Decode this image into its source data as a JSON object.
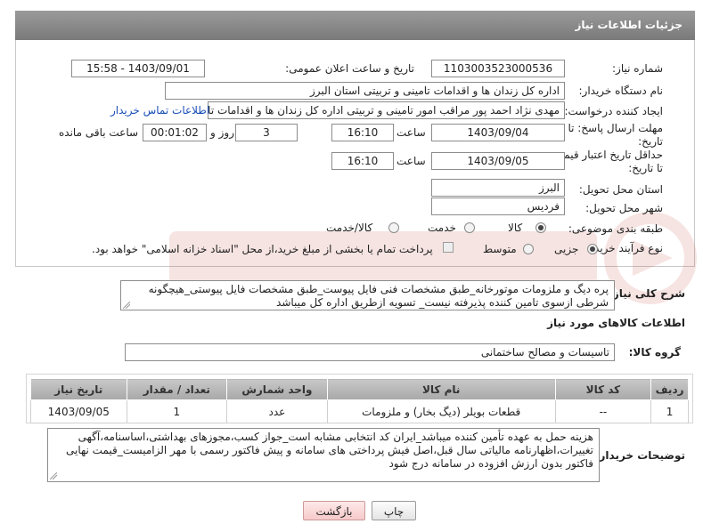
{
  "header": {
    "title": "جزئیات اطلاعات نیاز"
  },
  "fields": {
    "need_number": {
      "label": "شماره نیاز:",
      "value": "1103003523000536"
    },
    "announce": {
      "label": "تاریخ و ساعت اعلان عمومی:",
      "value": "1403/09/01 - 15:58"
    },
    "buyer_org": {
      "label": "نام دستگاه خریدار:",
      "value": "اداره کل زندان ها و اقدامات تامینی و تربیتی استان البرز"
    },
    "requester": {
      "label": "ایجاد کننده درخواست:",
      "value": "مهدی نژاد احمد پور مراقب امور تامینی و تربیتی اداره کل زندان ها و اقدامات تامینی",
      "link": "اطلاعات تماس خریدار"
    },
    "deadline": {
      "label": "مهلت ارسال پاسخ: تا تاریخ:",
      "date": "1403/09/04",
      "time_label": "ساعت",
      "time": "16:10",
      "days": "3",
      "days_label": "روز و",
      "remaining": "00:01:02",
      "remaining_label": "ساعت باقی مانده"
    },
    "validity": {
      "label": "حداقل تاریخ اعتبار قیمت: تا تاریخ:",
      "date": "1403/09/05",
      "time_label": "ساعت",
      "time": "16:10"
    },
    "province": {
      "label": "استان محل تحویل:",
      "value": "البرز"
    },
    "city": {
      "label": "شهر محل تحویل:",
      "value": "فردیس"
    },
    "category": {
      "label": "طبقه بندی موضوعی:",
      "options": [
        "کالا",
        "خدمت",
        "کالا/خدمت"
      ],
      "selected": "کالا"
    },
    "process": {
      "label": "نوع فرآیند خرید :",
      "options": [
        "جزیی",
        "متوسط"
      ],
      "selected": "جزیی",
      "note": "پرداخت تمام یا بخشی از مبلغ خرید،از محل \"اسناد خزانه اسلامی\" خواهد بود."
    }
  },
  "description": {
    "label": "شرح کلی نیاز:",
    "text": "پره دیگ و ملزومات موتورخانه_طبق مشخصات فنی فایل پیوست_طبق مشخصات فایل پیوستی_هیچگونه شرطی ازسوی تامین کننده پذیرفته نیست_ تسویه ازطریق اداره کل میباشد"
  },
  "goods_section": {
    "title": "اطلاعات کالاهای مورد نیاز",
    "group_label": "گروه کالا:",
    "group_value": "تاسیسات و مصالح ساختمانی"
  },
  "table": {
    "headers": [
      "ردیف",
      "کد کالا",
      "نام کالا",
      "واحد شمارش",
      "تعداد / مقدار",
      "تاریخ نیاز"
    ],
    "rows": [
      [
        "1",
        "--",
        "قطعات بویلر (دیگ بخار) و ملزومات",
        "عدد",
        "1",
        "1403/09/05"
      ]
    ]
  },
  "buyer_notes": {
    "label": "توضیحات خریدار:",
    "text": "هزینه حمل به عهده تأمین کننده میباشد_ایران کد انتخابی مشابه است_جواز کسب،مجوزهای بهداشتی،اساسنامه،آگهی تغییرات،اظهارنامه مالیاتی سال قبل،اصل فیش پرداختی های سامانه و پیش فاکتور رسمی با مهر الزامیست_قیمت نهایی فاکتور بدون ارزش افزوده در سامانه درج شود"
  },
  "buttons": {
    "print": "چاپ",
    "back": "بازگشت"
  },
  "colors": {
    "header_bg": "#8a8a8a",
    "link": "#1a4fb8",
    "back_button": "#f6c9c9"
  }
}
